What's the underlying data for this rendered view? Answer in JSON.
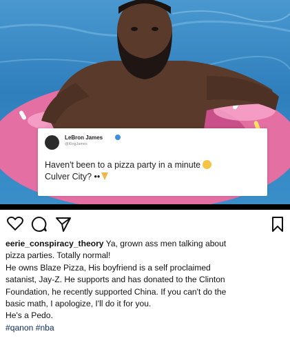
{
  "tweet": {
    "author_name": "LeBron James",
    "handle": "@KingJames",
    "text_line1": "Haven't been to a pizza party in a minute",
    "text_line2": "Culver City? ••"
  },
  "actions": {
    "like_icon": "heart-icon",
    "comment_icon": "comment-icon",
    "share_icon": "share-icon",
    "save_icon": "bookmark-icon"
  },
  "post": {
    "username": "eerie_conspiracy_theory",
    "caption_lines": [
      "Ya, grown ass men talking about",
      "pizza parties. Totally normal!",
      "He owns Blaze Pizza, His boyfriend is a self proclaimed",
      "satanist, Jay-Z. He supports and has donated to the Clinton",
      "Foundation, he recently supported China. If you can't do the",
      "basic math, I apologize, I'll do it for you.",
      "He's a Pedo."
    ],
    "hashtags": "#qanon #nba"
  },
  "colors": {
    "pool": "#3a8fc9",
    "float_pink": "#e46fa3",
    "verified": "#3b8fe0",
    "hashtag": "#0b2d63"
  }
}
